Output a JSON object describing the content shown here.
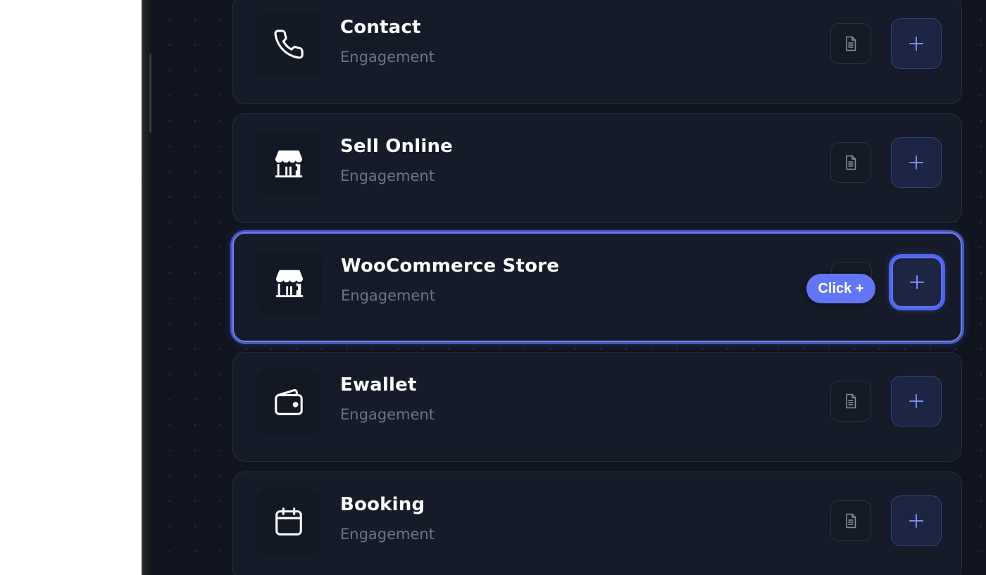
{
  "cards": [
    {
      "title": "Contact",
      "subtitle": "Engagement",
      "icon": "phone-icon"
    },
    {
      "title": "Sell Online",
      "subtitle": "Engagement",
      "icon": "store-icon"
    },
    {
      "title": "WooCommerce Store",
      "subtitle": "Engagement",
      "icon": "store-icon",
      "selected": true
    },
    {
      "title": "Ewallet",
      "subtitle": "Engagement",
      "icon": "wallet-icon"
    },
    {
      "title": "Booking",
      "subtitle": "Engagement",
      "icon": "calendar-icon"
    }
  ],
  "hint": {
    "label": "Click +"
  },
  "colors": {
    "accent": "#6276f5",
    "background": "#0f141e",
    "card": "#151b28",
    "subtitle": "#6b7587"
  }
}
